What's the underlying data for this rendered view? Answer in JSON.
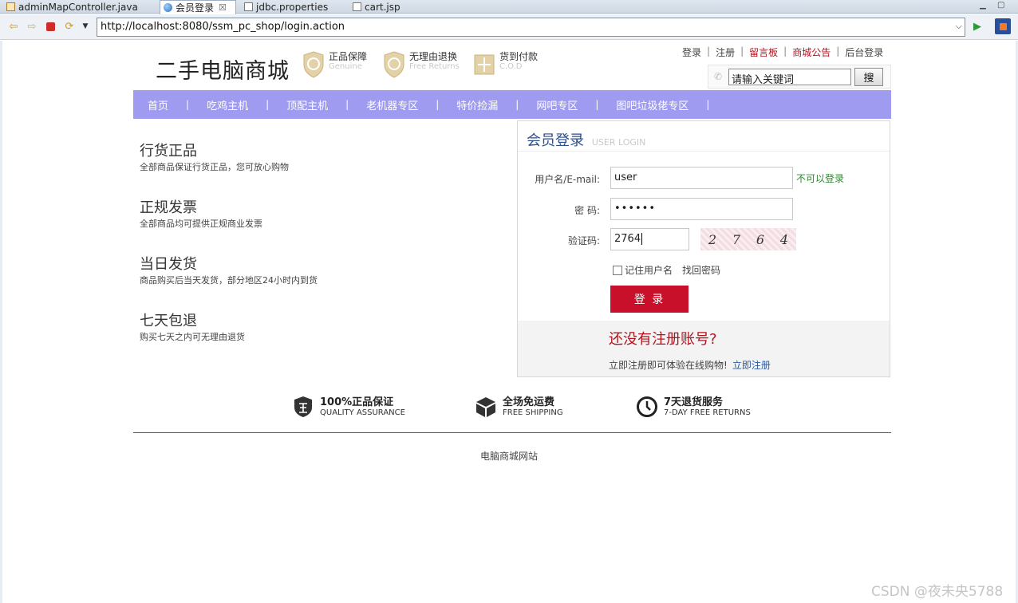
{
  "ide": {
    "tabs": [
      {
        "label": "adminMapController.java"
      },
      {
        "label": "会员登录",
        "close": "☒"
      },
      {
        "label": "jdbc.properties"
      },
      {
        "label": "cart.jsp"
      }
    ]
  },
  "browser": {
    "url": "http://localhost:8080/ssm_pc_shop/login.action"
  },
  "header": {
    "logo": "二手电脑商城",
    "assurances": [
      {
        "title": "正品保障",
        "sub": "Genuine"
      },
      {
        "title": "无理由退换",
        "sub": "Free Returns"
      },
      {
        "title": "货到付款",
        "sub": "C.O.D"
      }
    ],
    "links": [
      "登录",
      "注册",
      "留言板",
      "商城公告",
      "后台登录"
    ],
    "search_value": "请输入关键词",
    "search_button": "搜"
  },
  "menu": [
    "首页",
    "吃鸡主机",
    "顶配主机",
    "老机器专区",
    "特价捡漏",
    "网吧专区",
    "图吧垃圾佬专区"
  ],
  "features": [
    {
      "title": "行货正品",
      "desc": "全部商品保证行货正品，您可放心购物"
    },
    {
      "title": "正规发票",
      "desc": "全部商品均可提供正规商业发票"
    },
    {
      "title": "当日发货",
      "desc": "商品购买后当天发货，部分地区24小时内到货"
    },
    {
      "title": "七天包退",
      "desc": "购买七天之内可无理由退货"
    }
  ],
  "login": {
    "title": "会员登录",
    "title_en": "USER LOGIN",
    "username_label": "用户名/E-mail:",
    "username_value": "user",
    "username_status": "不可以登录",
    "password_label": "密  码:",
    "password_value": "••••••",
    "captcha_label": "验证码:",
    "captcha_value": "2764",
    "captcha_chars": [
      "2",
      "7",
      "6",
      "4"
    ],
    "remember_label": "记住用户名",
    "forgot_label": "找回密码",
    "submit_label": "登 录",
    "no_account": "还没有注册账号?",
    "register_tip": "立即注册即可体验在线购物!",
    "register_link": "立即注册"
  },
  "services": [
    {
      "title": "100%正品保证",
      "sub": "QUALITY ASSURANCE"
    },
    {
      "title": "全场免运费",
      "sub": "FREE SHIPPING"
    },
    {
      "title": "7天退货服务",
      "sub": "7-DAY FREE RETURNS"
    }
  ],
  "footer": "电脑商城网站",
  "watermark": "CSDN @夜未央5788"
}
